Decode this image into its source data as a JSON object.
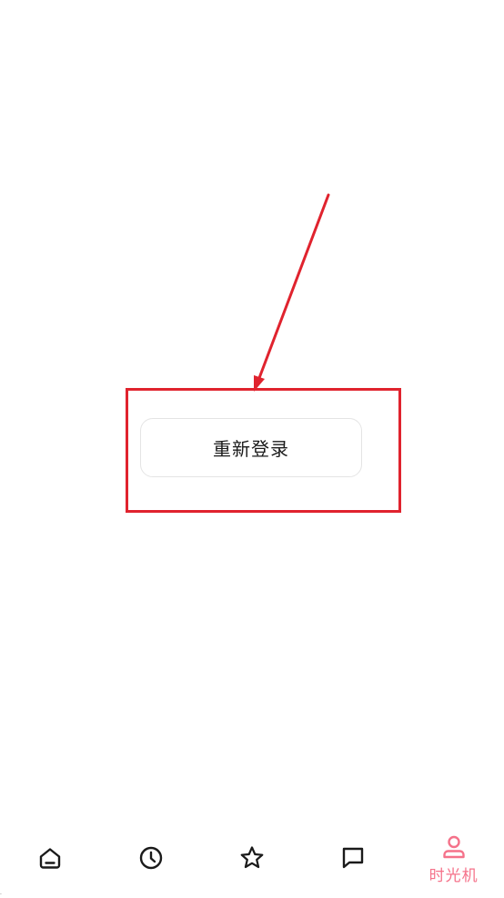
{
  "main": {
    "relogin_label": "重新登录"
  },
  "tab_bar": {
    "items": [
      {
        "icon": "home-icon",
        "label": ""
      },
      {
        "icon": "clock-icon",
        "label": ""
      },
      {
        "icon": "star-icon",
        "label": ""
      },
      {
        "icon": "chat-icon",
        "label": ""
      },
      {
        "icon": "user-icon",
        "label": "时光机",
        "active": true
      }
    ],
    "active_color": "#f5728a",
    "inactive_color": "#1a1a1a"
  },
  "annotation": {
    "color": "#e0232e"
  }
}
